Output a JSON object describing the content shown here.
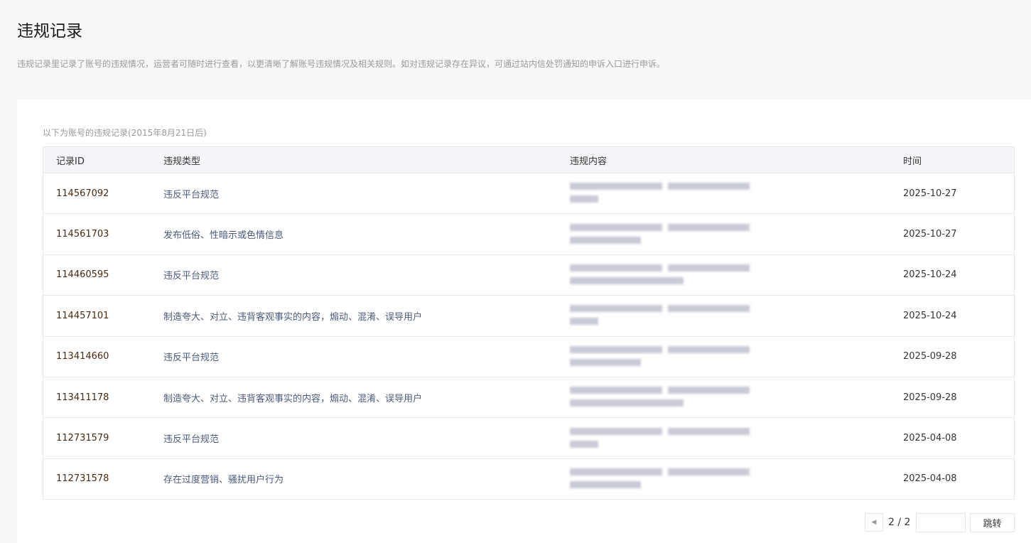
{
  "page": {
    "title": "违规记录",
    "description": "违规记录里记录了账号的违规情况，运营者可随时进行查看，以更清晰了解账号违规情况及相关规则。如对违规记录存在异议，可通过站内信处罚通知的申诉入口进行申诉。",
    "subtitle": "以下为账号的违规记录(2015年8月21日后)"
  },
  "table": {
    "headers": [
      "记录ID",
      "违规类型",
      "违规内容",
      "时间"
    ],
    "rows": [
      {
        "id": "114567092",
        "type": "违反平台规范",
        "time": "2025-10-27"
      },
      {
        "id": "114561703",
        "type": "发布低俗、性暗示或色情信息",
        "time": "2025-10-27"
      },
      {
        "id": "114460595",
        "type": "违反平台规范",
        "time": "2025-10-24"
      },
      {
        "id": "114457101",
        "type": "制造夸大、对立、违背客观事实的内容，煽动、混淆、误导用户",
        "time": "2025-10-24"
      },
      {
        "id": "113414660",
        "type": "违反平台规范",
        "time": "2025-09-28"
      },
      {
        "id": "113411178",
        "type": "制造夸大、对立、违背客观事实的内容，煽动、混淆、误导用户",
        "time": "2025-09-28"
      },
      {
        "id": "112731579",
        "type": "违反平台规范",
        "time": "2025-04-08"
      },
      {
        "id": "112731578",
        "type": "存在过度营销、骚扰用户行为",
        "time": "2025-04-08"
      }
    ]
  },
  "pagination": {
    "page_indicator": "2 / 2",
    "jump_label": "跳转",
    "prev_icon": "caret-left-icon"
  }
}
